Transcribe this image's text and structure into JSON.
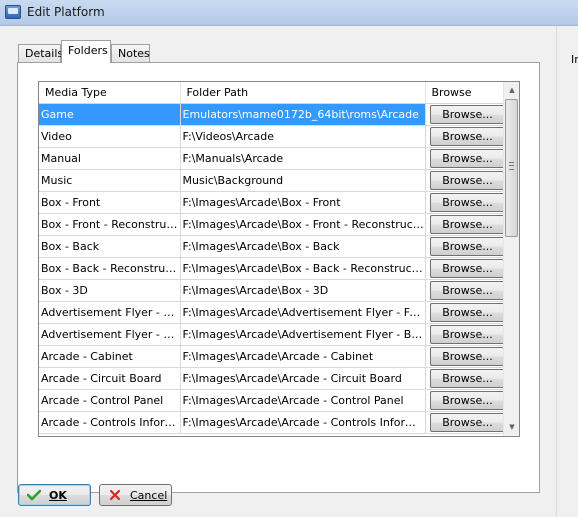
{
  "window": {
    "title": "Edit Platform"
  },
  "tabs": [
    {
      "label": "Details",
      "active": false
    },
    {
      "label": "Folders",
      "active": true
    },
    {
      "label": "Notes",
      "active": false
    }
  ],
  "grid": {
    "columns": [
      "Media Type",
      "Folder Path",
      "Browse"
    ],
    "browse_label": "Browse...",
    "selected_row": 0,
    "rows": [
      {
        "media_type": "Game",
        "folder_path": "Emulators\\mame0172b_64bit\\roms\\Arcade",
        "browse": "Browse..."
      },
      {
        "media_type": "Video",
        "folder_path": "F:\\Videos\\Arcade",
        "browse": "Browse..."
      },
      {
        "media_type": "Manual",
        "folder_path": "F:\\Manuals\\Arcade",
        "browse": "Browse..."
      },
      {
        "media_type": "Music",
        "folder_path": "Music\\Background",
        "browse": "Browse..."
      },
      {
        "media_type": "Box - Front",
        "folder_path": "F:\\Images\\Arcade\\Box - Front",
        "browse": "Browse..."
      },
      {
        "media_type": "Box - Front - Reconstructed",
        "folder_path": "F:\\Images\\Arcade\\Box - Front - Reconstructed",
        "browse": "Browse..."
      },
      {
        "media_type": "Box - Back",
        "folder_path": "F:\\Images\\Arcade\\Box - Back",
        "browse": "Browse..."
      },
      {
        "media_type": "Box - Back - Reconstructed",
        "folder_path": "F:\\Images\\Arcade\\Box - Back - Reconstructed",
        "browse": "Browse..."
      },
      {
        "media_type": "Box - 3D",
        "folder_path": "F:\\Images\\Arcade\\Box - 3D",
        "browse": "Browse..."
      },
      {
        "media_type": "Advertisement Flyer - Front",
        "folder_path": "F:\\Images\\Arcade\\Advertisement Flyer - Front",
        "browse": "Browse..."
      },
      {
        "media_type": "Advertisement Flyer - Back",
        "folder_path": "F:\\Images\\Arcade\\Advertisement Flyer - Back",
        "browse": "Browse..."
      },
      {
        "media_type": "Arcade - Cabinet",
        "folder_path": "F:\\Images\\Arcade\\Arcade - Cabinet",
        "browse": "Browse..."
      },
      {
        "media_type": "Arcade - Circuit Board",
        "folder_path": "F:\\Images\\Arcade\\Arcade - Circuit Board",
        "browse": "Browse..."
      },
      {
        "media_type": "Arcade - Control Panel",
        "folder_path": "F:\\Images\\Arcade\\Arcade - Control Panel",
        "browse": "Browse..."
      },
      {
        "media_type": "Arcade - Controls Inform...",
        "folder_path": "F:\\Images\\Arcade\\Arcade - Controls Information",
        "browse": "Browse..."
      }
    ]
  },
  "right_pane": {
    "label": "In"
  },
  "buttons": {
    "ok_label": "OK",
    "cancel_label": "Cancel"
  },
  "icons": {
    "ok": "checkmark-icon",
    "cancel": "x-icon",
    "app": "monitor-icon"
  },
  "colors": {
    "selection": "#3399ff",
    "ok_check": "#2ca02c",
    "cancel_x": "#d62728"
  }
}
